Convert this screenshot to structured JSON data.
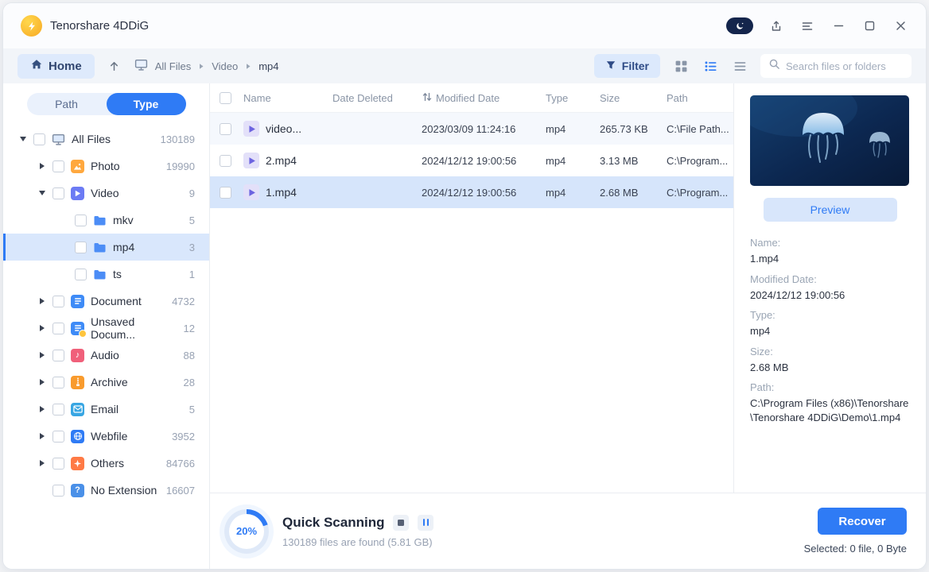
{
  "window": {
    "title": "Tenorshare 4DDiG"
  },
  "toolbar": {
    "home": "Home",
    "breadcrumb": [
      "All Files",
      "Video",
      "mp4"
    ],
    "filter": "Filter",
    "search_placeholder": "Search files or folders"
  },
  "sidebar": {
    "tabs": {
      "path": "Path",
      "type": "Type"
    },
    "tree": [
      {
        "label": "All Files",
        "count": "130189"
      },
      {
        "label": "Photo",
        "count": "19990"
      },
      {
        "label": "Video",
        "count": "9"
      },
      {
        "label": "mkv",
        "count": "5"
      },
      {
        "label": "mp4",
        "count": "3"
      },
      {
        "label": "ts",
        "count": "1"
      },
      {
        "label": "Document",
        "count": "4732"
      },
      {
        "label": "Unsaved Docum...",
        "count": "12"
      },
      {
        "label": "Audio",
        "count": "88"
      },
      {
        "label": "Archive",
        "count": "28"
      },
      {
        "label": "Email",
        "count": "5"
      },
      {
        "label": "Webfile",
        "count": "3952"
      },
      {
        "label": "Others",
        "count": "84766"
      },
      {
        "label": "No Extension",
        "count": "16607"
      }
    ]
  },
  "table": {
    "headers": {
      "name": "Name",
      "date_deleted": "Date Deleted",
      "modified": "Modified Date",
      "type": "Type",
      "size": "Size",
      "path": "Path"
    },
    "rows": [
      {
        "name": "video...",
        "date_deleted": "",
        "modified": "2023/03/09 11:24:16",
        "type": "mp4",
        "size": "265.73 KB",
        "path": "C:\\File Path..."
      },
      {
        "name": "2.mp4",
        "date_deleted": "",
        "modified": "2024/12/12 19:00:56",
        "type": "mp4",
        "size": "3.13 MB",
        "path": "C:\\Program..."
      },
      {
        "name": "1.mp4",
        "date_deleted": "",
        "modified": "2024/12/12 19:00:56",
        "type": "mp4",
        "size": "2.68 MB",
        "path": "C:\\Program..."
      }
    ]
  },
  "preview": {
    "button": "Preview",
    "fields": [
      {
        "label": "Name:",
        "value": "1.mp4"
      },
      {
        "label": "Modified Date:",
        "value": "2024/12/12 19:00:56"
      },
      {
        "label": "Type:",
        "value": "mp4"
      },
      {
        "label": "Size:",
        "value": "2.68 MB"
      },
      {
        "label": "Path:",
        "value": "C:\\Program Files (x86)\\Tenorshare\\Tenorshare 4DDiG\\Demo\\1.mp4"
      }
    ]
  },
  "footer": {
    "progress": "20%",
    "status_title": "Quick Scanning",
    "status_detail": "130189 files are found (5.81 GB)",
    "recover": "Recover",
    "selected": "Selected: 0 file, 0 Byte"
  },
  "colors": {
    "accent": "#2F7BF5",
    "accent_light": "#DCE9FC",
    "selected_row": "#D6E5FB"
  }
}
